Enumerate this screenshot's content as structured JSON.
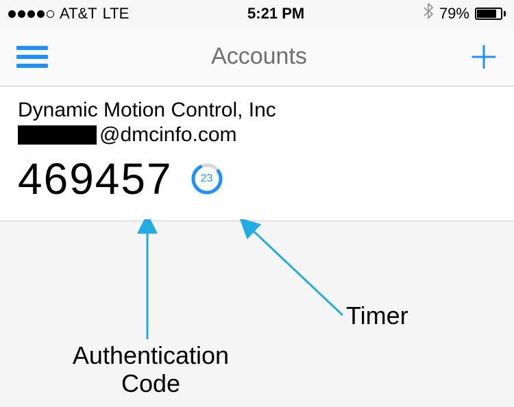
{
  "status_bar": {
    "carrier": "AT&T",
    "network_type": "LTE",
    "time": "5:21 PM",
    "battery_pct": "79%",
    "signal_filled": 4,
    "signal_total": 5
  },
  "nav": {
    "title": "Accounts"
  },
  "account": {
    "name": "Dynamic Motion Control, Inc",
    "email_domain": "@dmcinfo.com",
    "code": "469457",
    "timer_seconds": "23"
  },
  "annotations": {
    "code_label": "Authentication\nCode",
    "timer_label": "Timer"
  },
  "colors": {
    "accent": "#1e90ff",
    "arrow": "#22ace3"
  }
}
